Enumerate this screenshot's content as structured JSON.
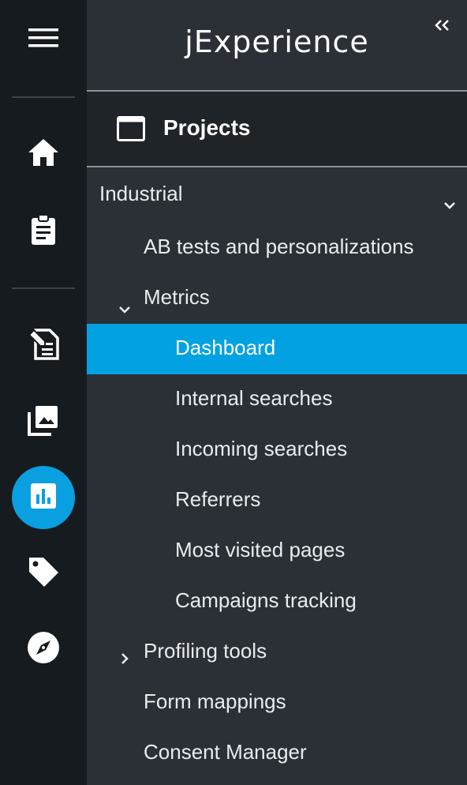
{
  "app": {
    "logo": "jExperience"
  },
  "rail": {
    "icons": [
      "menu-icon",
      "home-icon",
      "clipboard-icon",
      "edit-document-icon",
      "gallery-icon",
      "bar-chart-icon",
      "tag-icon",
      "compass-icon"
    ],
    "active": "bar-chart-icon",
    "accent": "#0a9fe0"
  },
  "header": {
    "title": "Projects"
  },
  "nav": {
    "group": {
      "label": "Industrial",
      "expanded": true
    },
    "items": {
      "ab_tests": "AB tests and personalizations",
      "metrics": "Metrics",
      "dashboard": "Dashboard",
      "internal_searches": "Internal searches",
      "incoming_searches": "Incoming searches",
      "referrers": "Referrers",
      "most_visited": "Most visited pages",
      "campaigns": "Campaigns tracking",
      "profiling": "Profiling tools",
      "form_mappings": "Form mappings",
      "consent": "Consent Manager"
    },
    "selected": "Dashboard",
    "selected_color": "#02a2e2"
  }
}
